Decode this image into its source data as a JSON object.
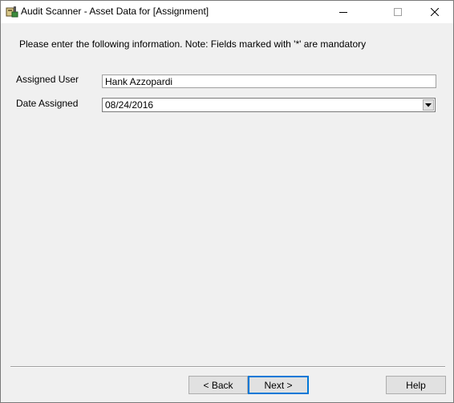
{
  "window": {
    "title": "Audit Scanner - Asset Data for [Assignment]",
    "icons": {
      "app": "scanner-app-icon",
      "minimize": "minimize-icon",
      "maximize": "maximize-icon",
      "close": "close-icon"
    }
  },
  "form": {
    "instruction": "Please enter the following information. Note: Fields marked with '*' are mandatory",
    "fields": {
      "assigned_user": {
        "label": "Assigned User",
        "value": "Hank Azzopardi"
      },
      "date_assigned": {
        "label": "Date Assigned",
        "value": "08/24/2016"
      }
    }
  },
  "buttons": {
    "back": "< Back",
    "next": "Next >",
    "help": "Help"
  },
  "colors": {
    "background": "#f0f0f0",
    "titlebar": "#ffffff",
    "default_button_border": "#0078d7"
  }
}
